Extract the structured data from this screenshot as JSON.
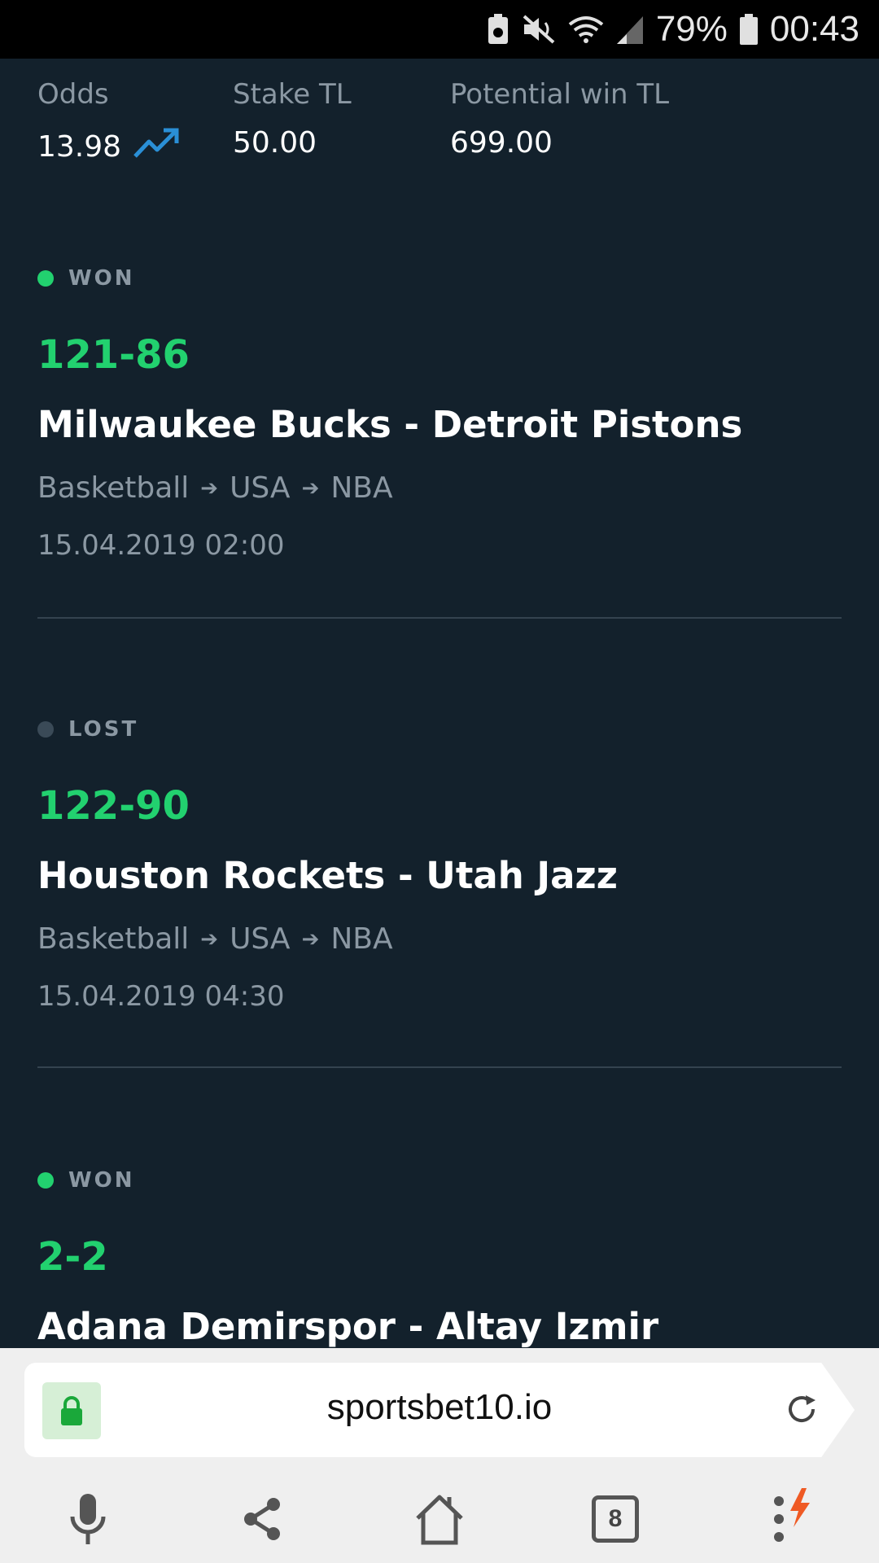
{
  "status_bar": {
    "battery_percent": "79%",
    "time": "00:43"
  },
  "summary": {
    "odds_label": "Odds",
    "odds_value": "13.98",
    "stake_label": "Stake TL",
    "stake_value": "50.00",
    "potential_label": "Potential win TL",
    "potential_value": "699.00",
    "trend_icon": "trending-up-icon",
    "trend_color": "#2a8fd6"
  },
  "bets": [
    {
      "status": "WON",
      "status_color": "#22d16f",
      "score": "121-86",
      "match": "Milwaukee Bucks - Detroit Pistons",
      "sport": "Basketball",
      "country": "USA",
      "league": "NBA",
      "datetime": "15.04.2019 02:00"
    },
    {
      "status": "LOST",
      "status_color": "#3a4a57",
      "score": "122-90",
      "match": "Houston Rockets - Utah Jazz",
      "sport": "Basketball",
      "country": "USA",
      "league": "NBA",
      "datetime": "15.04.2019 04:30"
    },
    {
      "status": "WON",
      "status_color": "#22d16f",
      "score": "2-2",
      "match": "Adana Demirspor - Altay Izmir"
    }
  ],
  "browser": {
    "url": "sportsbet10.io",
    "tab_count": "8"
  }
}
